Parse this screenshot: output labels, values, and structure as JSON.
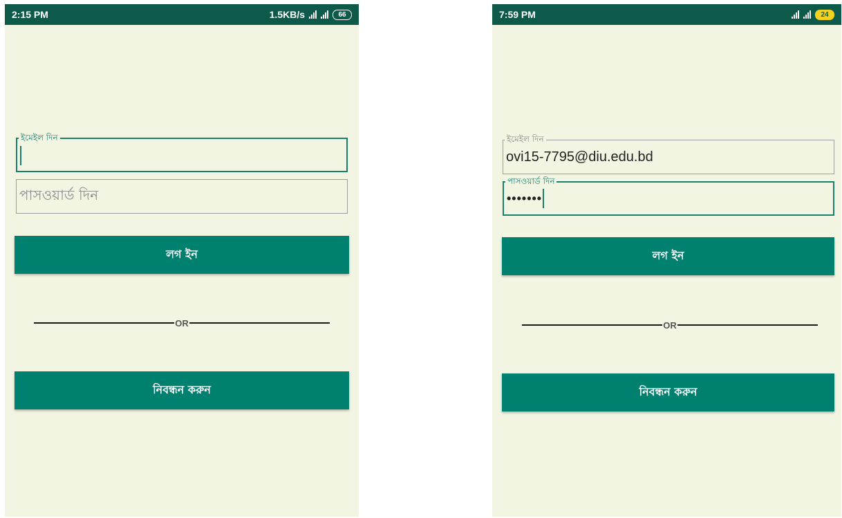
{
  "left_screen": {
    "status": {
      "time": "2:15 PM",
      "speed": "1.5KB/s",
      "battery": "66"
    },
    "email_label": "ইমেইল দিন",
    "password_placeholder": "পাসওয়ার্ড দিন",
    "login_label": "লগ ইন",
    "or_label": "OR",
    "register_label": "নিবন্ধন করুন"
  },
  "right_screen": {
    "status": {
      "time": "7:59 PM",
      "battery": "24"
    },
    "email_label": "ইমেইল দিন",
    "email_value": "ovi15-7795@diu.edu.bd",
    "password_label": "পাসওয়ার্ড দিন",
    "password_value": "•••••••",
    "login_label": "লগ ইন",
    "or_label": "OR",
    "register_label": "নিবন্ধন করুন"
  },
  "colors": {
    "status_bar": "#0e5a4a",
    "background": "#f1f5e2",
    "accent": "#00806f",
    "focus_border": "#17806d"
  },
  "icons": [
    "signal-icon",
    "battery-icon"
  ]
}
